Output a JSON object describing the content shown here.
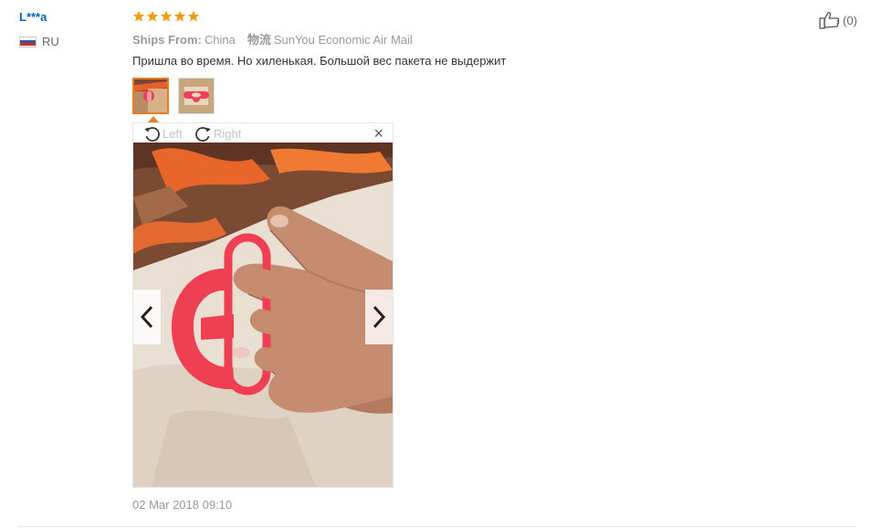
{
  "review": {
    "user_name": "L***a",
    "country_code": "RU",
    "rating": 5,
    "ships_from_label": "Ships From:",
    "ships_from_value": "China",
    "logistics_label": "物流",
    "logistics_value": "SunYou Economic Air Mail",
    "text": "Пришла во время. Но хиленькая. Большой вес пакета не выдержит",
    "date": "02 Mar 2018 09:10",
    "helpful_count": "(0)"
  },
  "viewer": {
    "rotate_left_label": "Left",
    "rotate_right_label": "Right",
    "close_icon": "close-icon",
    "prev_icon": "chevron-left-icon",
    "next_icon": "chevron-right-icon"
  },
  "colors": {
    "username": "#0066bb",
    "star": "#f39c12",
    "thumb_active_border": "#e67e22",
    "product_red": "#ef3f52"
  }
}
